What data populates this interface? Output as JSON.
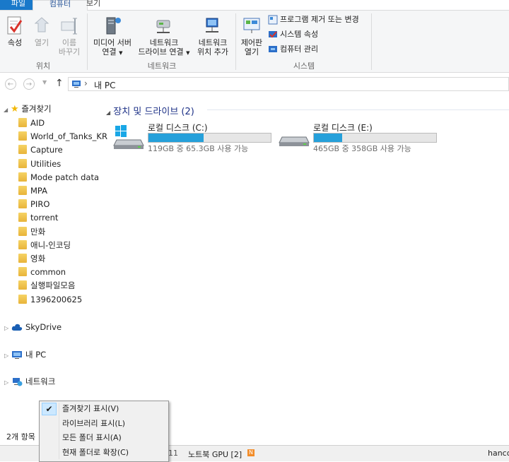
{
  "tabs": {
    "file": "파일",
    "computer": "컴퓨터",
    "view": "보기"
  },
  "ribbon": {
    "location": {
      "label": "위치",
      "properties": "속성",
      "open": "열기",
      "rename_1": "이름",
      "rename_2": "바꾸기"
    },
    "network": {
      "label": "네트워크",
      "media_1": "미디어 서버",
      "media_2": "연결",
      "map_1": "네트워크",
      "map_2": "드라이브 연결",
      "addloc_1": "네트워크",
      "addloc_2": "위치 추가"
    },
    "system": {
      "label": "시스템",
      "control_1": "제어판",
      "control_2": "열기",
      "uninstall": "프로그램 제거 또는 변경",
      "sysprops": "시스템 속성",
      "manage": "컴퓨터 관리"
    }
  },
  "address": {
    "path": "내 PC",
    "separator": "›"
  },
  "nav": {
    "favorites": "즐겨찾기",
    "folders": [
      "AID",
      "World_of_Tanks_KR",
      "Capture",
      "Utilities",
      "Mode patch data",
      "MPA",
      "PIRO",
      "torrent",
      "만화",
      "애니-인코딩",
      "영화",
      "common",
      "실행파일모음",
      "1396200625"
    ],
    "skydrive": "SkyDrive",
    "mypc": "내 PC",
    "network": "네트워크"
  },
  "content": {
    "section_title": "장치 및 드라이브 (2)",
    "drives": [
      {
        "name": "로컬 디스크 (C:)",
        "info": "119GB 중 65.3GB 사용 가능",
        "used_fraction": 0.45
      },
      {
        "name": "로컬 디스크 (E:)",
        "info": "465GB 중 358GB 사용 가능",
        "used_fraction": 0.23
      }
    ]
  },
  "status": {
    "count": "2개 항목"
  },
  "taskbar": {
    "left": "11",
    "gpu": "노트북 GPU [2]",
    "badge": "N",
    "right": "hanco"
  },
  "context_menu": {
    "items": [
      {
        "label": "즐겨찾기 표시(V)",
        "checked": true
      },
      {
        "label": "라이브러리 표시(L)",
        "checked": false
      },
      {
        "label": "모든 폴더 표시(A)",
        "checked": false
      },
      {
        "label": "현재 폴더로 확장(C)",
        "checked": false
      }
    ]
  },
  "colors": {
    "accent": "#1979ca",
    "drive_fill": "#26a0da",
    "section_title": "#1e3287"
  }
}
